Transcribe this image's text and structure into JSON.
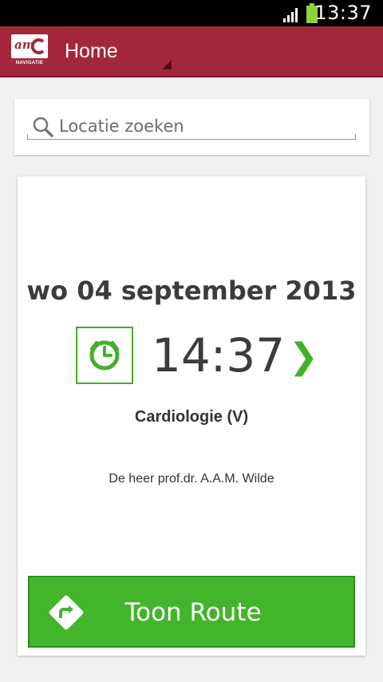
{
  "status_bar": {
    "time": "13:37",
    "icons": [
      "signal-icon",
      "battery-icon"
    ]
  },
  "action_bar": {
    "logo_text": "am",
    "logo_caption": "NAVIGATIE",
    "title": "Home",
    "color": "#a3273a"
  },
  "search": {
    "placeholder": "Locatie zoeken",
    "value": ""
  },
  "appointment": {
    "date": "wo 04 september 2013",
    "time": "14:37",
    "department": "Cardiologie (V)",
    "doctor": "De heer prof.dr. A.A.M. Wilde"
  },
  "route_button": {
    "label": "Toon Route",
    "color": "#43b52b"
  },
  "colors": {
    "accent_green": "#43b02a",
    "brand_red": "#a3273a"
  }
}
